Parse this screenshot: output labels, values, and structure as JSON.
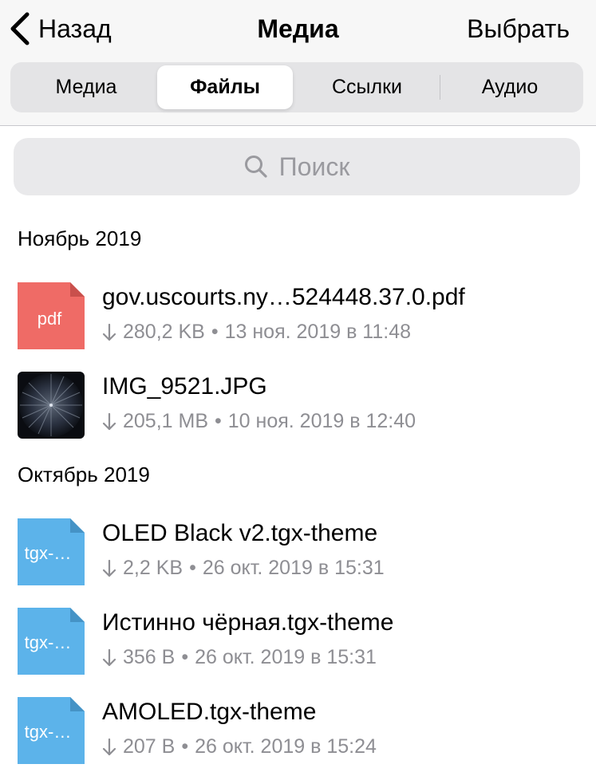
{
  "nav": {
    "back_label": "Назад",
    "title": "Медиа",
    "select_label": "Выбрать"
  },
  "tabs": [
    {
      "label": "Медиа",
      "active": false
    },
    {
      "label": "Файлы",
      "active": true
    },
    {
      "label": "Ссылки",
      "active": false
    },
    {
      "label": "Аудио",
      "active": false
    }
  ],
  "search": {
    "placeholder": "Поиск",
    "icon": "search-icon"
  },
  "sections": [
    {
      "title": "Ноябрь 2019",
      "files": [
        {
          "name": "gov.uscourts.ny…524448.37.0.pdf",
          "icon_label": "pdf",
          "icon_color": "#ef6b66",
          "size": "280,2 KB",
          "date": "13 ноя. 2019 в 11:48"
        },
        {
          "name": "IMG_9521.JPG",
          "icon_label": "",
          "icon_color": "#0c1018",
          "size": "205,1 MB",
          "date": "10 ноя. 2019 в 12:40"
        }
      ]
    },
    {
      "title": "Октябрь 2019",
      "files": [
        {
          "name": "OLED Black v2.tgx-theme",
          "icon_label": "tgx-…",
          "icon_color": "#5cb3ea",
          "size": "2,2 KB",
          "date": "26 окт. 2019 в 15:31"
        },
        {
          "name": "Истинно чёрная.tgx-theme",
          "icon_label": "tgx-…",
          "icon_color": "#5cb3ea",
          "size": "356 B",
          "date": "26 окт. 2019 в 15:31"
        },
        {
          "name": "AMOLED.tgx-theme",
          "icon_label": "tgx-…",
          "icon_color": "#5cb3ea",
          "size": "207 B",
          "date": "26 окт. 2019 в 15:24"
        }
      ]
    }
  ],
  "meta_separator": "•"
}
